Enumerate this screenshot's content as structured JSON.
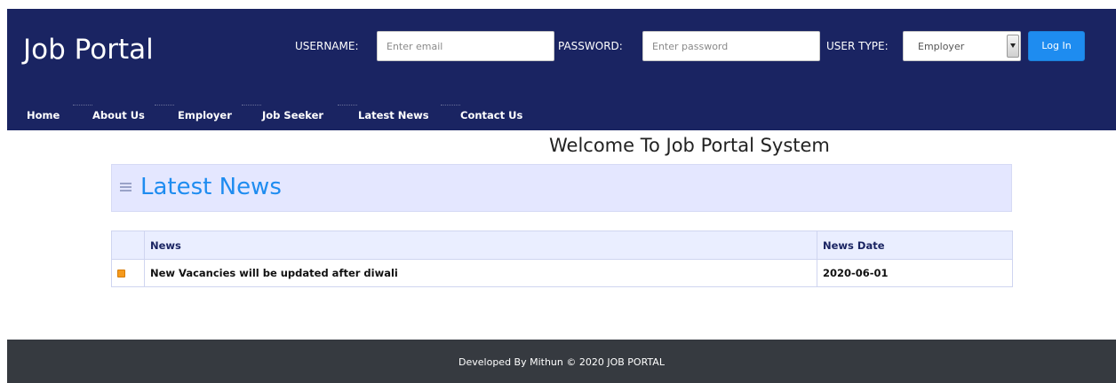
{
  "brand": "Job Portal",
  "login": {
    "username_label": "USERNAME:",
    "username_placeholder": "Enter email",
    "password_label": "PASSWORD:",
    "password_placeholder": "Enter password",
    "usertype_label": "USER TYPE:",
    "usertype_value": "Employer",
    "login_label": "Log In"
  },
  "nav": {
    "items": [
      "Home",
      "About Us",
      "Employer",
      "Job Seeker",
      "Latest News",
      "Contact Us"
    ]
  },
  "main": {
    "welcome": "Welcome To Job Portal System",
    "section_title": "Latest News",
    "table": {
      "headers": [
        "News",
        "News Date"
      ],
      "rows": [
        {
          "icon": "news-bullet-icon",
          "news": "New Vacancies will be updated after diwali",
          "date": "2020-06-01"
        }
      ]
    }
  },
  "footer": {
    "text": "Developed By Mithun © 2020 JOB PORTAL"
  },
  "colors": {
    "header_bg": "#1a2462",
    "accent": "#1e8cf0",
    "panel_bg": "#e4e7ff",
    "footer_bg": "#363a40",
    "bullet": "#f59a1d"
  }
}
